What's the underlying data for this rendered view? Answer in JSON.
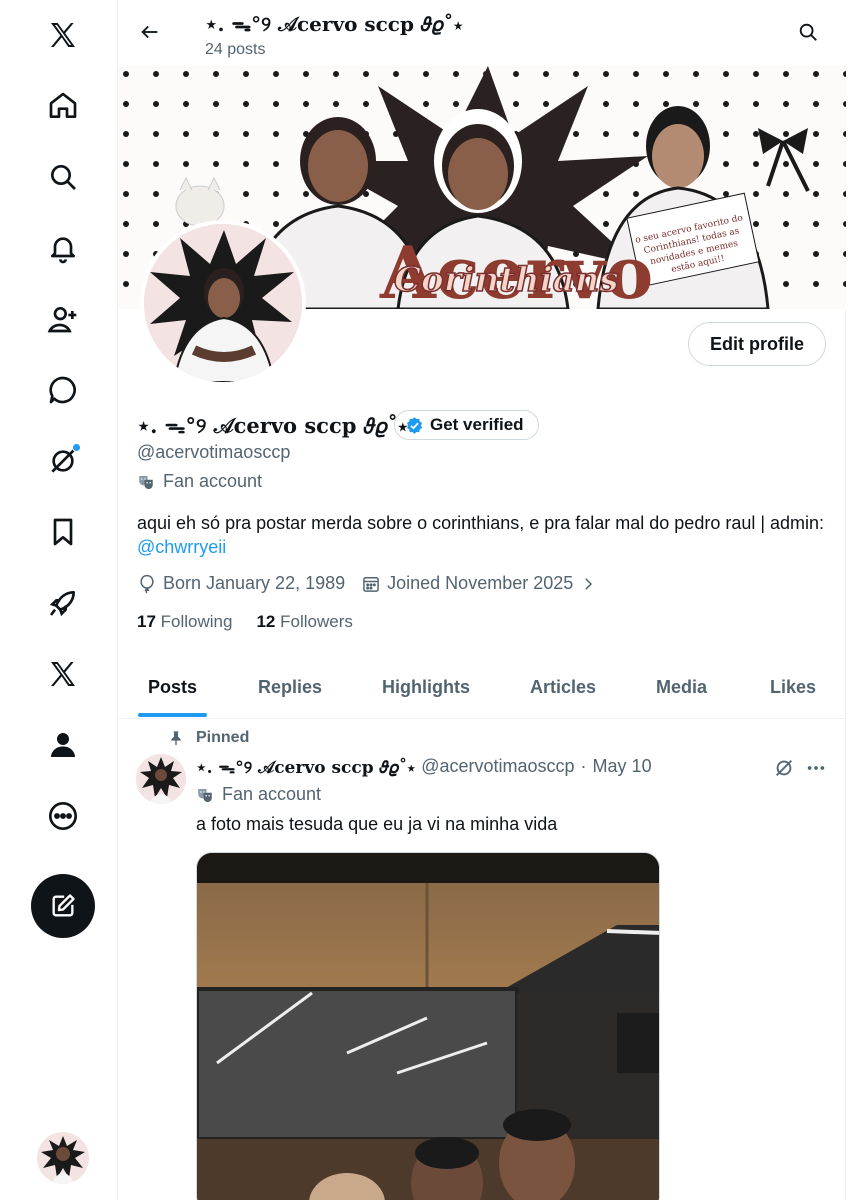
{
  "sidebar": {
    "items": [
      {
        "icon": "x-logo-icon"
      },
      {
        "icon": "home-icon"
      },
      {
        "icon": "search-icon"
      },
      {
        "icon": "bell-icon"
      },
      {
        "icon": "add-person-icon"
      },
      {
        "icon": "chat-icon"
      },
      {
        "icon": "grok-icon"
      },
      {
        "icon": "bookmark-icon"
      },
      {
        "icon": "rocket-icon"
      },
      {
        "icon": "x-premium-icon"
      },
      {
        "icon": "profile-icon"
      },
      {
        "icon": "more-icon"
      }
    ],
    "compose_icon": "compose-icon"
  },
  "header": {
    "name": "⋆. ᯓ°୨ 𝒜cervo sccp 𝜗𝜚˚⋆",
    "post_count": "24 posts"
  },
  "profile": {
    "display_name": "⋆. ᯓ°୨ 𝒜cervo sccp 𝜗𝜚˚⋆",
    "get_verified_label": "Get verified",
    "handle": "@acervotimaosccp",
    "category": "Fan account",
    "bio_text": "aqui eh só pra postar merda sobre o corinthians, e pra falar mal do pedro raul | admin: ",
    "bio_link": "@chwrryeii",
    "born": "Born January 22, 1989",
    "joined": "Joined November 2025",
    "following_count": "17",
    "following_label": "Following",
    "followers_count": "12",
    "followers_label": "Followers",
    "edit_profile_label": "Edit profile"
  },
  "banner": {
    "title": "Acervo",
    "subtitle": "Corinthians",
    "note": "o seu acervo favorito do Corinthians! todas as novidades e memes estão aqui!!"
  },
  "tabs": [
    {
      "label": "Posts",
      "active": true
    },
    {
      "label": "Replies",
      "active": false
    },
    {
      "label": "Highlights",
      "active": false
    },
    {
      "label": "Articles",
      "active": false
    },
    {
      "label": "Media",
      "active": false
    },
    {
      "label": "Likes",
      "active": false
    }
  ],
  "post": {
    "pinned_label": "Pinned",
    "author_name": "⋆. ᯓ°୨ 𝒜cervo sccp 𝜗𝜚˚⋆",
    "author_handle": "@acervotimaosccp",
    "date": "May 10",
    "category": "Fan account",
    "text": "a foto mais tesuda que eu ja vi na minha vida"
  },
  "colors": {
    "accent": "#1d9bf0",
    "text": "#0f1419",
    "secondary": "#536471"
  }
}
